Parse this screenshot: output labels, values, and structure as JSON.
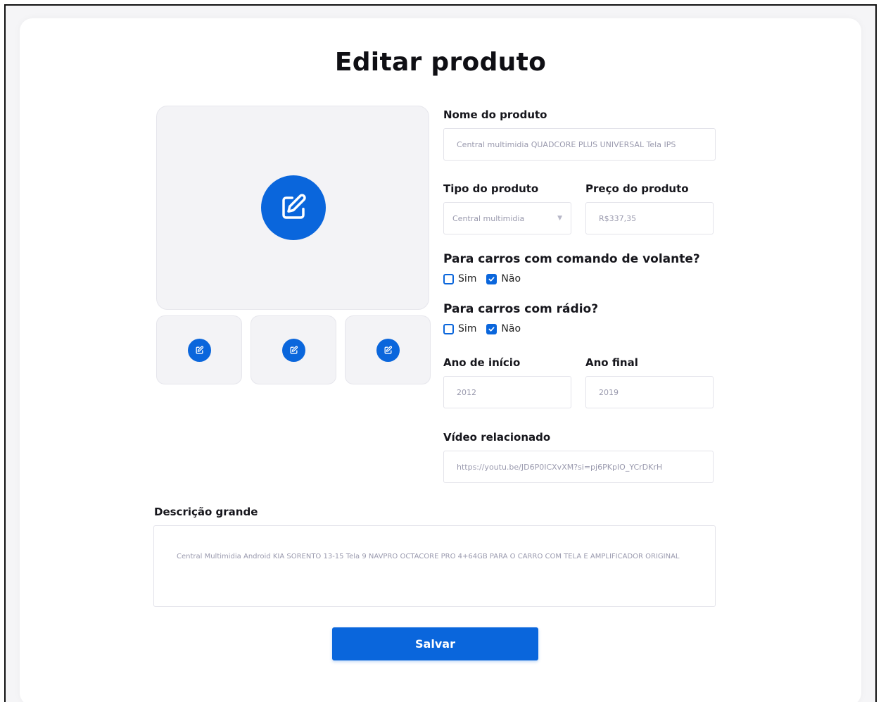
{
  "page": {
    "title": "Editar produto"
  },
  "icons": {
    "edit": "edit-icon",
    "checkbox_checked": "check-icon",
    "dropdown": "chevron-down-icon"
  },
  "colors": {
    "accent": "#0a66dc",
    "panel_bg": "#f3f3f6",
    "placeholder": "#9a9aae"
  },
  "form": {
    "product_name": {
      "label": "Nome do produto",
      "value": "Central multimidia QUADCORE PLUS UNIVERSAL Tela IPS"
    },
    "product_type": {
      "label": "Tipo do produto",
      "value": "Central multimidia"
    },
    "product_price": {
      "label": "Preço do produto",
      "value": "R$337,35"
    },
    "steering_control": {
      "label": "Para carros com comando de volante?",
      "options": [
        {
          "label": "Sim",
          "checked": false
        },
        {
          "label": "Não",
          "checked": true
        }
      ]
    },
    "radio": {
      "label": "Para carros com rádio?",
      "options": [
        {
          "label": "Sim",
          "checked": false
        },
        {
          "label": "Não",
          "checked": true
        }
      ]
    },
    "start_year": {
      "label": "Ano de início",
      "value": "2012"
    },
    "end_year": {
      "label": "Ano final",
      "value": "2019"
    },
    "video": {
      "label": "Vídeo relacionado",
      "value": "https://youtu.be/JD6P0ICXvXM?si=pj6PKpIO_YCrDKrH"
    },
    "description": {
      "label": "Descrição grande",
      "value": "Central Multimidia Android KIA SORENTO 13-15 Tela 9 NAVPRO OCTACORE PRO 4+64GB PARA O CARRO COM TELA E AMPLIFICADOR ORIGINAL"
    }
  },
  "actions": {
    "save_label": "Salvar"
  }
}
